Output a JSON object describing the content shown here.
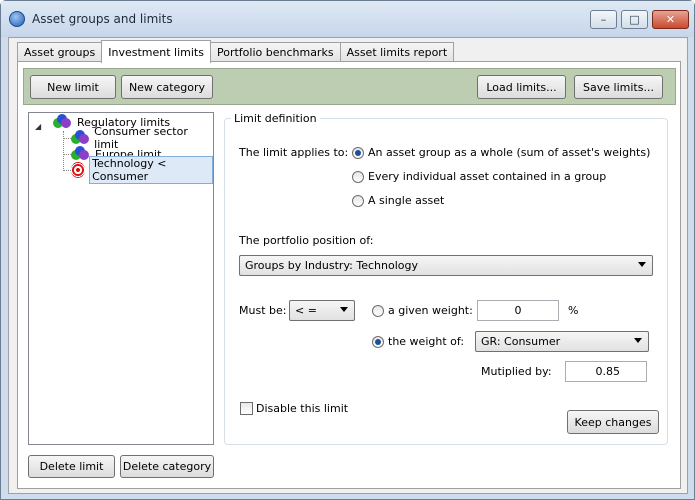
{
  "window": {
    "title": "Asset groups and limits",
    "minimize_glyph": "–",
    "maximize_glyph": "□",
    "close_glyph": "✕"
  },
  "tabs": [
    {
      "label": "Asset groups",
      "active": false
    },
    {
      "label": "Investment limits",
      "active": true
    },
    {
      "label": "Portfolio benchmarks",
      "active": false
    },
    {
      "label": "Asset limits report",
      "active": false
    }
  ],
  "toolbar": {
    "new_limit": "New limit",
    "new_category": "New category",
    "load_limits": "Load limits...",
    "save_limits": "Save limits..."
  },
  "tree": {
    "root": {
      "label": "Regulatory limits",
      "icon": "three-balls-icon"
    },
    "children": [
      {
        "label": "Consumer sector limit",
        "icon": "three-balls-icon"
      },
      {
        "label": "Europe limit",
        "icon": "three-balls-icon"
      },
      {
        "label": "Technology < Consumer",
        "icon": "target-icon",
        "selected": true
      }
    ]
  },
  "bottom_buttons": {
    "delete_limit": "Delete limit",
    "delete_category": "Delete category"
  },
  "limit_definition": {
    "group_title": "Limit definition",
    "applies_to_label": "The limit applies to:",
    "applies_options": [
      {
        "label": "An asset group as a whole (sum of asset's weights)",
        "checked": true
      },
      {
        "label": "Every individual asset contained in a group",
        "checked": false
      },
      {
        "label": "A single asset",
        "checked": false
      }
    ],
    "position_label": "The portfolio position of:",
    "position_value": "Groups by Industry: Technology",
    "must_be_label": "Must be:",
    "operator_value": "< =",
    "given_weight_label": "a given weight:",
    "given_weight_value": "0",
    "percent": "%",
    "weight_of_label": "the weight of:",
    "weight_of_value": "GR: Consumer",
    "multiplied_label": "Mutiplied by:",
    "multiplied_value": "0.85",
    "disable_label": "Disable this limit",
    "keep_changes": "Keep changes"
  },
  "colors": {
    "toolbar_bg": "#bccdb1",
    "selection": "#dde9f7",
    "radio_dot": "#1c4f9a"
  }
}
